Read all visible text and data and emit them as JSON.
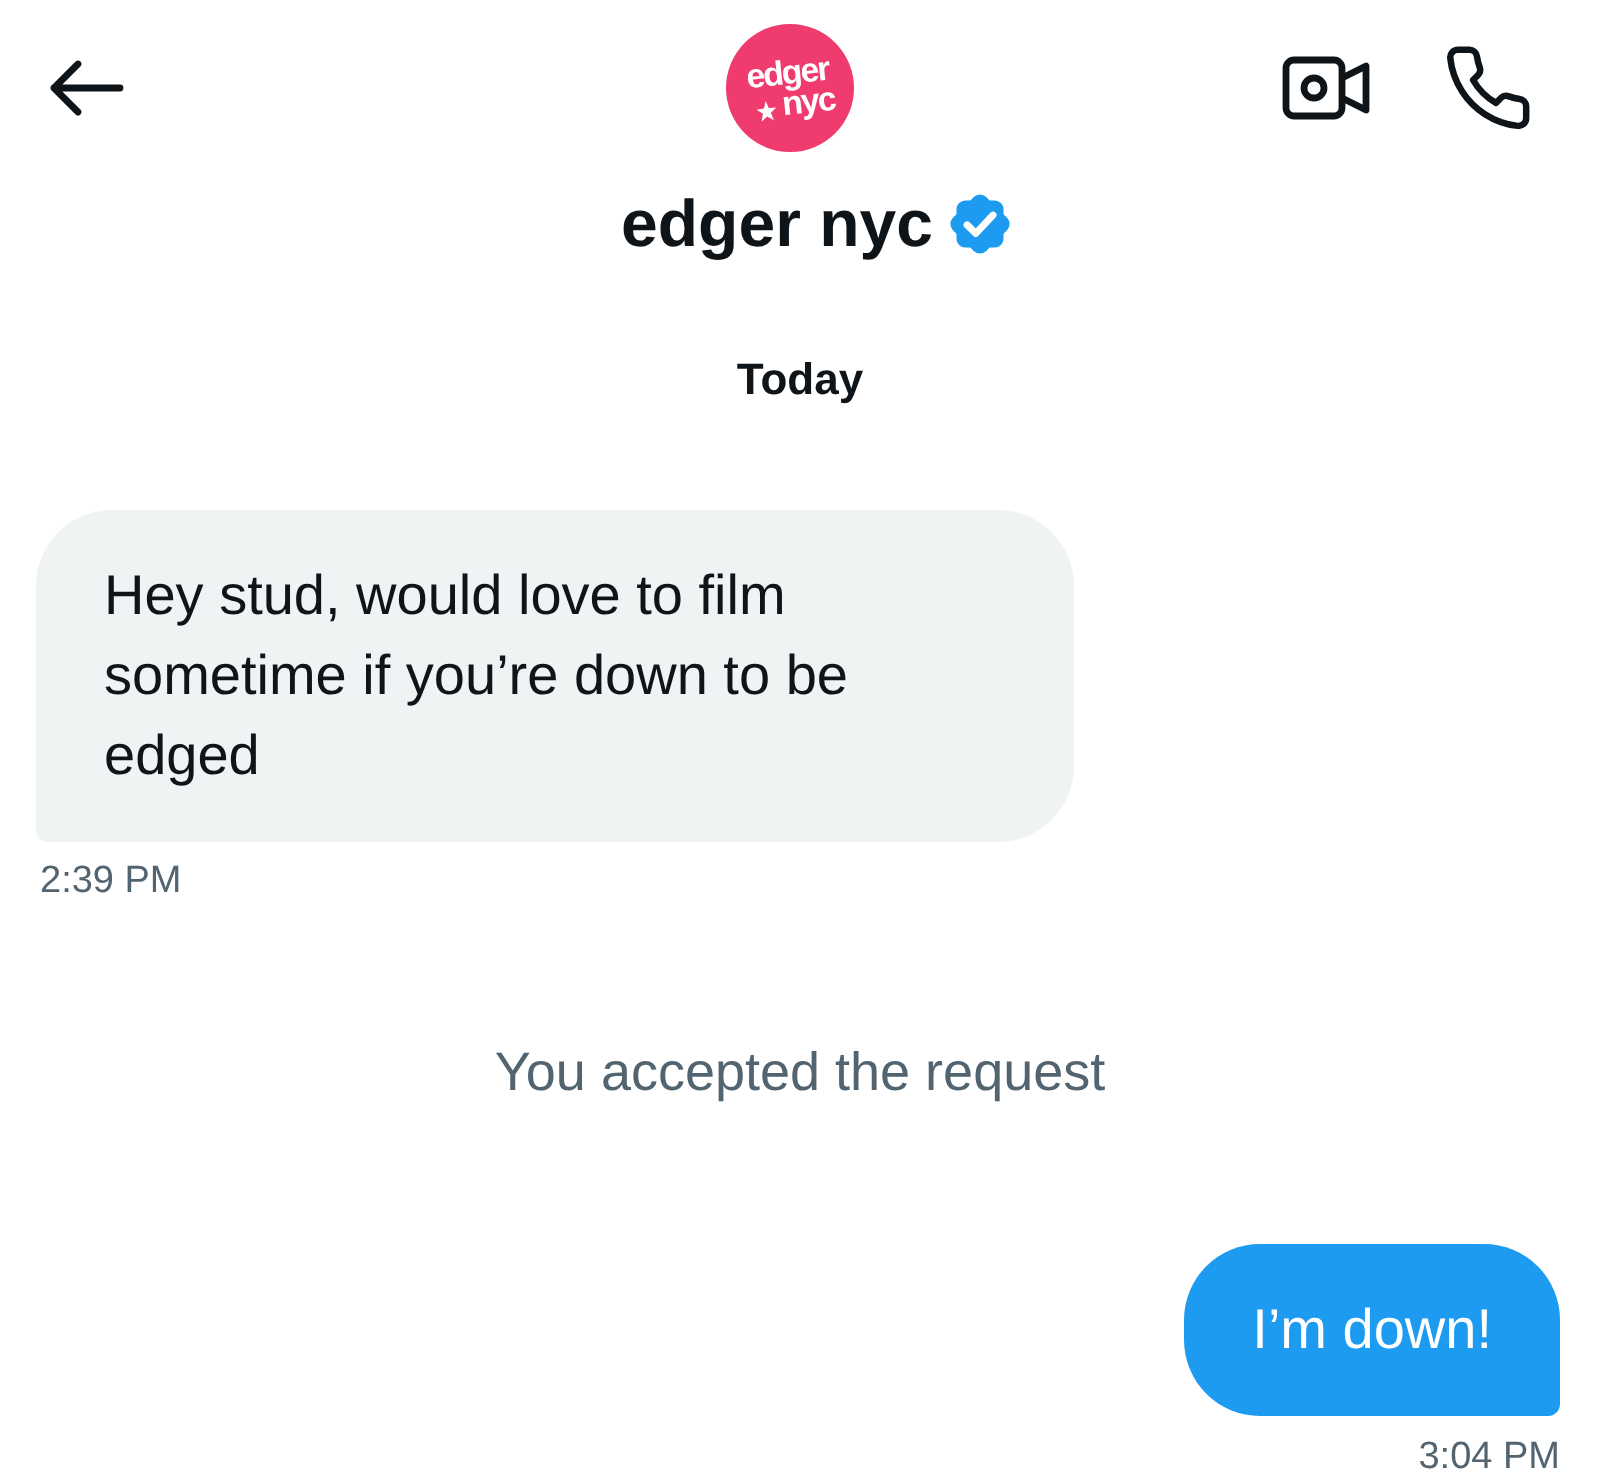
{
  "header": {
    "avatar": {
      "logo_lines": [
        "edger",
        "nyc"
      ]
    },
    "title": "edger nyc",
    "verified": true
  },
  "day_label": "Today",
  "messages": [
    {
      "kind": "incoming",
      "text": "Hey stud, would love to film sometime if you’re down to be edged",
      "time": "2:39 PM"
    },
    {
      "kind": "system",
      "text": "You accepted the request"
    },
    {
      "kind": "outgoing",
      "text": "I’m down!",
      "time": "3:04 PM"
    }
  ]
}
